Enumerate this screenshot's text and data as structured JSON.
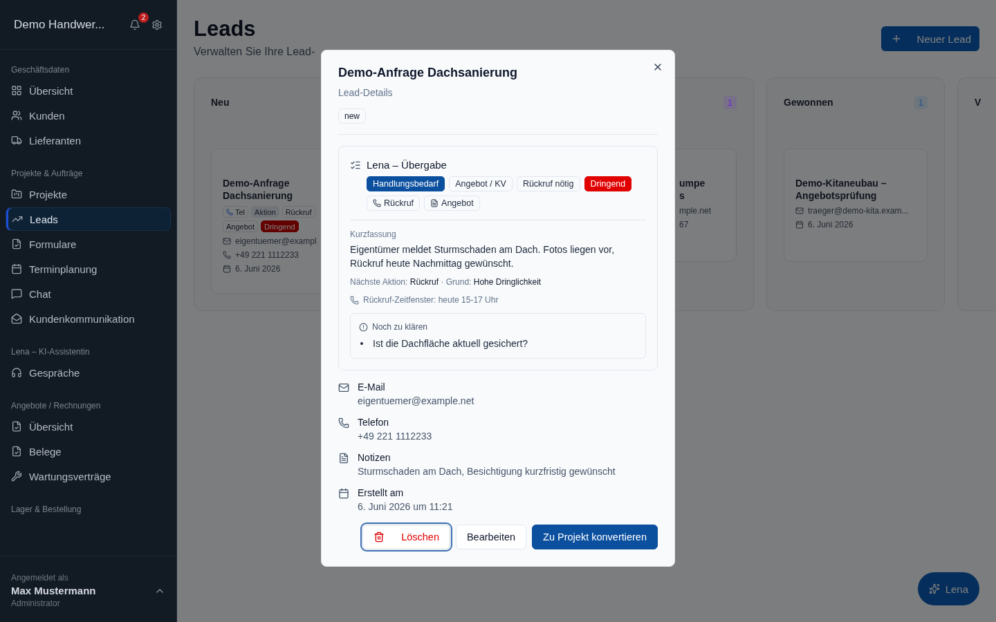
{
  "sidebar": {
    "brand": "Demo Handwer...",
    "notification_count": "2",
    "sections": [
      {
        "title": "Geschäftsdaten",
        "items": [
          {
            "label": "Übersicht",
            "selected": false
          },
          {
            "label": "Kunden",
            "selected": false
          },
          {
            "label": "Lieferanten",
            "selected": false
          }
        ]
      },
      {
        "title": "Projekte & Aufträge",
        "items": [
          {
            "label": "Projekte",
            "selected": false
          },
          {
            "label": "Leads",
            "selected": true
          },
          {
            "label": "Formulare",
            "selected": false
          },
          {
            "label": "Terminplanung",
            "selected": false
          },
          {
            "label": "Chat",
            "selected": false
          },
          {
            "label": "Kundenkommunikation",
            "selected": false
          }
        ]
      },
      {
        "title": "Lena – KI-Assistentin",
        "items": [
          {
            "label": "Gespräche",
            "selected": false
          }
        ]
      },
      {
        "title": "Angebote / Rechnungen",
        "items": [
          {
            "label": "Übersicht",
            "selected": false
          },
          {
            "label": "Belege",
            "selected": false
          },
          {
            "label": "Wartungsverträge",
            "selected": false
          }
        ]
      },
      {
        "title": "Lager & Bestellung"
      }
    ],
    "user": {
      "caption": "Angemeldet als",
      "name": "Max Mustermann",
      "role": "Administrator"
    }
  },
  "page": {
    "title": "Leads",
    "subtitle": "Verwalten Sie Ihre Lead-",
    "new_button": "Neuer Lead"
  },
  "columns": [
    {
      "title": "Neu",
      "cards": [
        {
          "title_lines": [
            "Demo-Anfrage",
            "Dachsanierung"
          ],
          "chips": [
            {
              "label": "Tel",
              "kind": "phone"
            },
            {
              "label": "Aktion",
              "kind": "muted"
            },
            {
              "label": "Rückruf",
              "kind": "outline"
            },
            {
              "label": "Angebot",
              "kind": "outline"
            },
            {
              "label": "Dringend",
              "kind": "danger"
            }
          ],
          "email": "eigentuemer@exampl",
          "phone": "+49 221 1112233",
          "date": "6. Juni 2026"
        }
      ]
    },
    {},
    {
      "count": "1",
      "color": "#6d28d9",
      "cards": [
        {
          "title_lines": [
            "umpe",
            "s"
          ],
          "email": "mple.net",
          "phone": "67"
        }
      ]
    },
    {
      "title": "Gewonnen",
      "count": "1",
      "color": "#1e4f8a",
      "cards": [
        {
          "title_lines": [
            "Demo-Kitaneubau –",
            "Angebotsprüfung"
          ],
          "email": "traeger@demo-kita.exam...",
          "date": "6. Juni 2026"
        }
      ]
    },
    {
      "title": "V"
    }
  ],
  "dialog": {
    "title": "Demo-Anfrage Dachsanierung",
    "subtitle": "Lead-Details",
    "status": "new",
    "handover": {
      "title": "Lena – Übergabe",
      "tags": [
        {
          "label": "Handlungsbedarf",
          "kind": "primary"
        },
        {
          "label": "Angebot / KV",
          "kind": "outline"
        },
        {
          "label": "Rückruf nötig",
          "kind": "outline"
        },
        {
          "label": "Dringend",
          "kind": "danger"
        }
      ],
      "actions": [
        {
          "label": "Rückruf",
          "kind": "phone"
        },
        {
          "label": "Angebot",
          "kind": "document"
        }
      ],
      "summary_label": "Kurzfassung",
      "summary": "Eigentümer meldet Sturmschaden am Dach. Fotos liegen vor, Rückruf heute Nachmittag gewünscht.",
      "next_action": "Nächste Aktion: **Rückruf**  ·  Grund: **Hohe Dringlichkeit**",
      "callback_window": "Rückruf-Zeitfenster: heute 15-17 Uhr",
      "open_questions": {
        "title": "Noch zu klären",
        "marker": "•",
        "items": [
          "Ist die Dachfläche aktuell gesichert?"
        ]
      }
    },
    "details": [
      {
        "kind": "email",
        "label": "E-Mail",
        "value": "eigentuemer@example.net"
      },
      {
        "kind": "phone",
        "label": "Telefon",
        "value": "+49 221 1112233"
      },
      {
        "kind": "notes",
        "label": "Notizen",
        "value": "Sturmschaden am Dach, Besichtigung kurzfristig gewünscht"
      },
      {
        "kind": "date",
        "label": "Erstellt am",
        "value": "6. Juni 2026 um 11:21"
      }
    ],
    "buttons": [
      {
        "label": "Löschen",
        "kind": "danger",
        "focused": true
      },
      {
        "label": "Bearbeiten",
        "kind": "secondary",
        "focused": false
      },
      {
        "label": "Zu Projekt konvertieren",
        "kind": "primary",
        "focused": false
      }
    ]
  },
  "assistant_button": "Lena"
}
